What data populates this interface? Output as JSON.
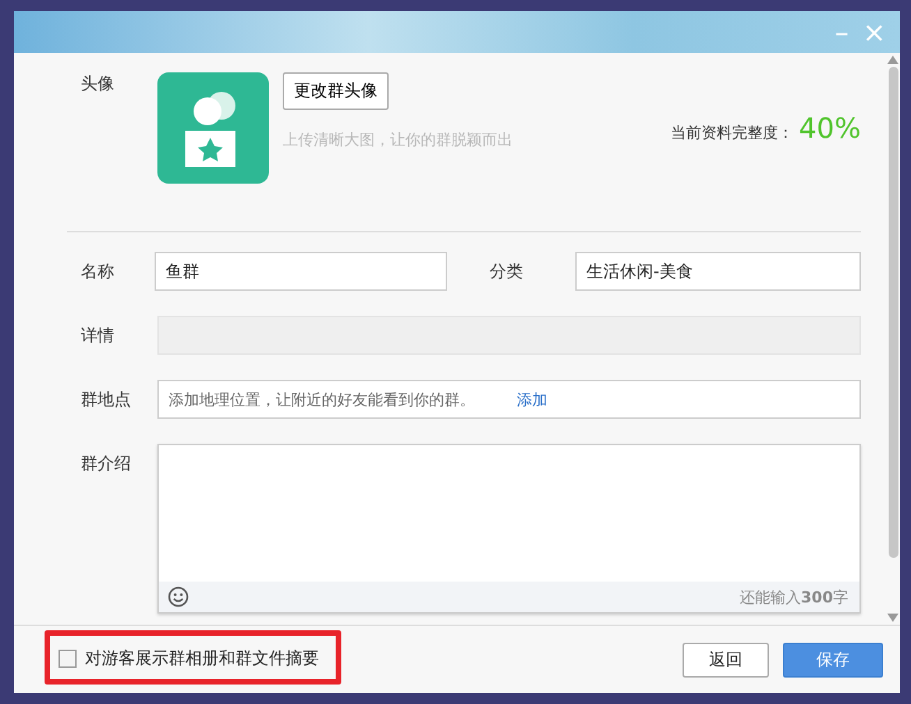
{
  "dialog": {
    "minimize": "–",
    "close": "×"
  },
  "avatar": {
    "label": "头像",
    "change_button": "更改群头像",
    "hint": "上传清晰大图，让你的群脱颖而出",
    "completeness_label": "当前资料完整度：",
    "completeness": "40%"
  },
  "fields": [
    {
      "kind": "pair",
      "label": "名称",
      "value": "鱼群",
      "label2": "分类",
      "value2": "生活休闲-美食"
    },
    {
      "kind": "disabled",
      "label": "详情"
    },
    {
      "kind": "location",
      "label": "群地点",
      "placeholder": "添加地理位置，让附近的好友能看到你的群。",
      "link": "添加"
    },
    {
      "kind": "textarea",
      "label": "群介绍",
      "counter": "还能输入**300**字"
    }
  ],
  "footer": {
    "checkbox": {
      "label": "对游客展示群相册和群文件摘要",
      "checked": false
    },
    "highlighted": true,
    "buttons": [
      {
        "label": "返回",
        "primary": false
      },
      {
        "label": "保存",
        "primary": true
      }
    ]
  }
}
